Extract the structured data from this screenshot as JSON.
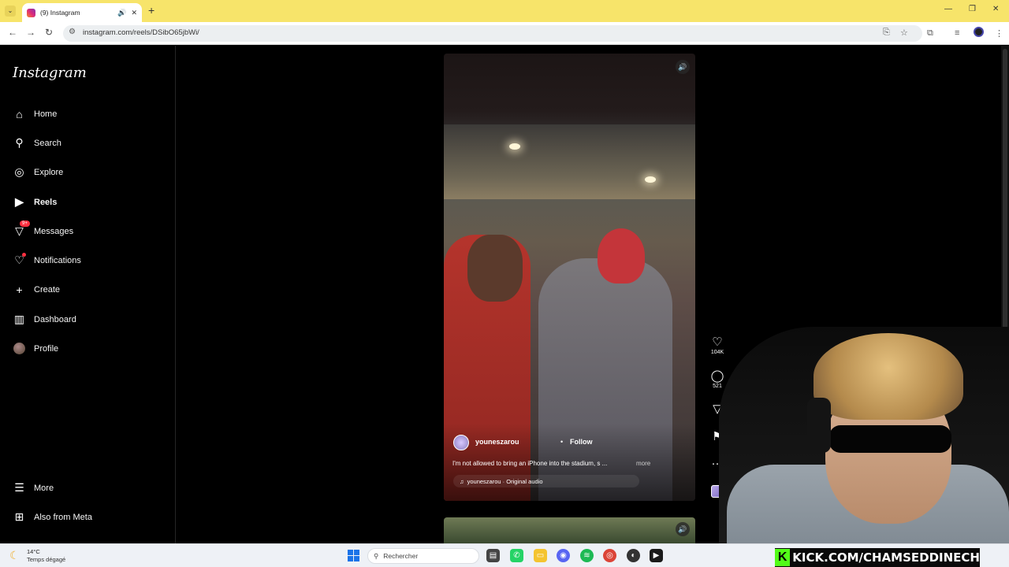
{
  "browser": {
    "tab_title": "(9) Instagram",
    "url": "instagram.com/reels/DSibO65jbWi/",
    "new_tab_symbol": "+",
    "menu_symbol": "⋮"
  },
  "sidebar": {
    "logo": "Instagram",
    "items": [
      {
        "label": "Home",
        "icon": "home-icon"
      },
      {
        "label": "Search",
        "icon": "search-icon"
      },
      {
        "label": "Explore",
        "icon": "compass-icon"
      },
      {
        "label": "Reels",
        "icon": "reels-icon"
      },
      {
        "label": "Messages",
        "icon": "messenger-icon",
        "badge": "9+"
      },
      {
        "label": "Notifications",
        "icon": "heart-icon"
      },
      {
        "label": "Create",
        "icon": "plus-icon"
      },
      {
        "label": "Dashboard",
        "icon": "dashboard-icon"
      },
      {
        "label": "Profile",
        "icon": "avatar"
      }
    ],
    "bottom_items": [
      {
        "label": "More",
        "icon": "menu-icon"
      },
      {
        "label": "Also from Meta",
        "icon": "meta-icon"
      }
    ]
  },
  "reel": {
    "author": "youneszarou",
    "separator": "•",
    "follow_label": "Follow",
    "caption": "I'm not allowed to bring an iPhone into the stadium, s ...",
    "more_label": "more",
    "audio": "youneszarou · Original audio"
  },
  "actions": {
    "likes": "104K",
    "comments": "521"
  },
  "stream_overlay": {
    "kick_letter": "K",
    "kick_text": "KICK.COM/CHAMSEDDINECH"
  },
  "taskbar": {
    "temperature": "14°C",
    "weather": "Temps dégagé",
    "search_placeholder": "Rechercher"
  },
  "colors": {
    "tab_strip": "#f7e46a",
    "ig_background": "#000000",
    "notification_red": "#ff3040",
    "kick_green": "#53fc18"
  }
}
